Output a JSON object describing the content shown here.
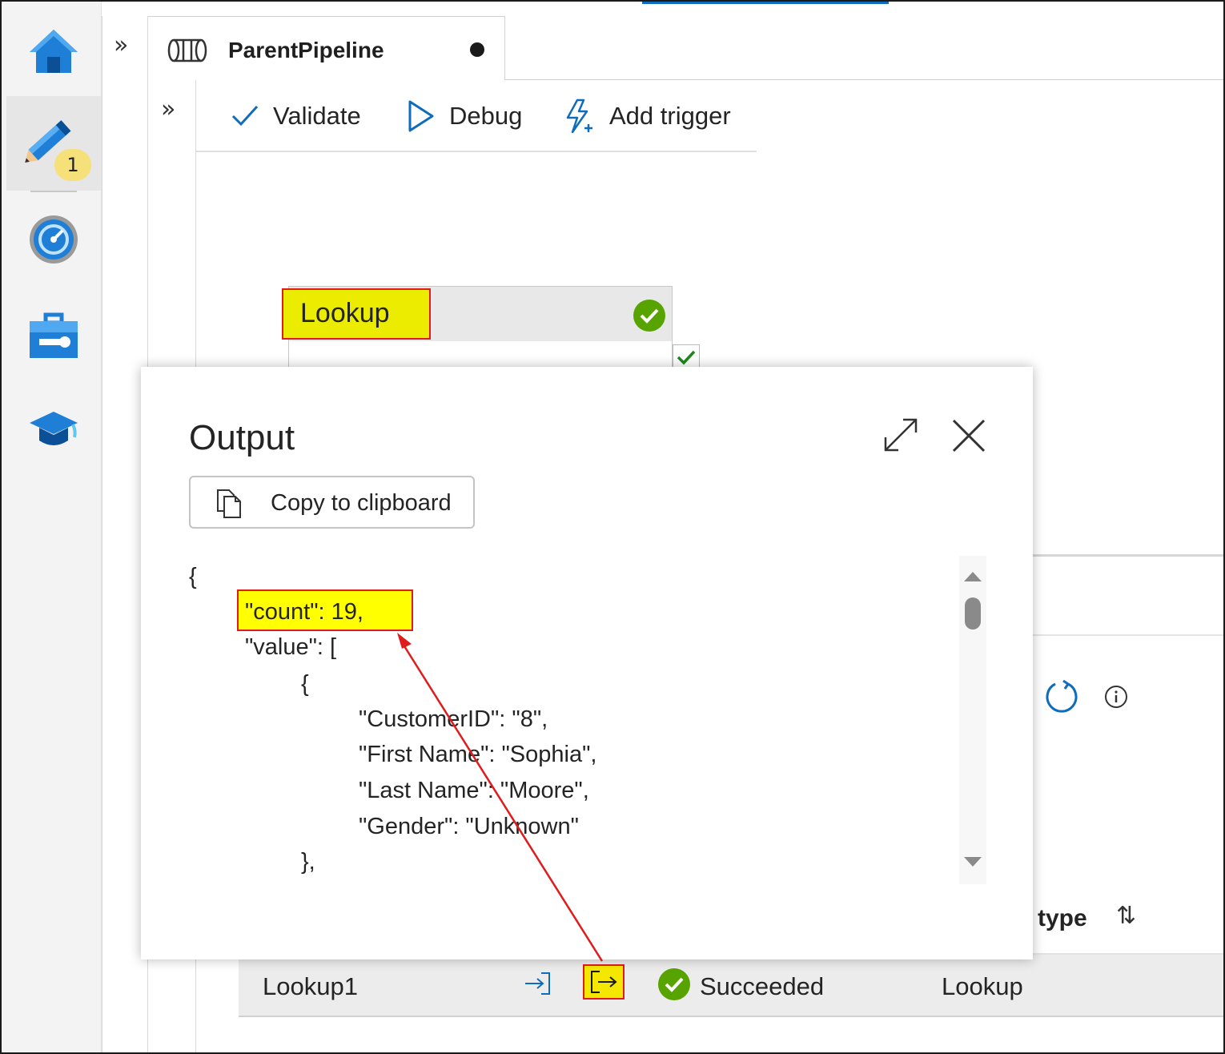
{
  "nav": {
    "badge_count": "1",
    "items": [
      {
        "icon": "home-icon"
      },
      {
        "icon": "author-pencil-icon",
        "active": true
      },
      {
        "icon": "monitor-gauge-icon"
      },
      {
        "icon": "manage-toolbox-icon"
      },
      {
        "icon": "learning-center-icon"
      }
    ]
  },
  "tab": {
    "title": "ParentPipeline",
    "unsaved": true,
    "icon": "pipeline-icon"
  },
  "toolbar": {
    "validate_label": "Validate",
    "debug_label": "Debug",
    "add_trigger_label": "Add trigger"
  },
  "canvas": {
    "activity_title": "Lookup",
    "activity_status": "succeeded"
  },
  "output_dialog": {
    "title": "Output",
    "copy_label": "Copy to clipboard",
    "code_lines": [
      "{",
      "\"count\": 19,",
      "\"value\": [",
      "{",
      "\"CustomerID\": \"8\",",
      "\"First Name\": \"Sophia\",",
      "\"Last Name\": \"Moore\",",
      "\"Gender\": \"Unknown\"",
      "},"
    ]
  },
  "runs": {
    "column_type_label": "type",
    "rows": [
      {
        "name": "Lookup1",
        "status": "Succeeded",
        "type": "Lookup"
      }
    ]
  },
  "colors": {
    "accent": "#0f6cbd",
    "success": "#57a300",
    "highlight": "#ffff00",
    "annotation": "#e01b1b"
  }
}
